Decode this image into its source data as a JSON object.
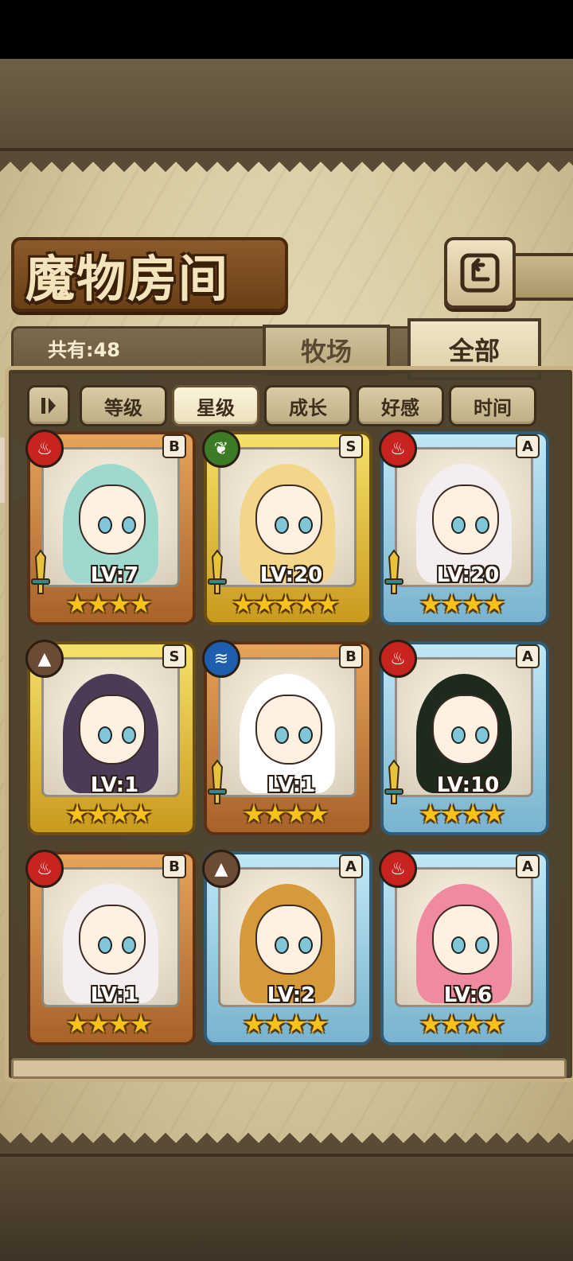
{
  "header": {
    "title": "魔物房间",
    "back_icon": "return-arrow-icon"
  },
  "summary": {
    "count_label": "共有:48"
  },
  "tabs": [
    {
      "label": "牧场",
      "active": false
    },
    {
      "label": "全部",
      "active": true
    }
  ],
  "sort": {
    "toggle_icon": "sort-order-icon",
    "options": [
      {
        "label": "等级",
        "active": false
      },
      {
        "label": "星级",
        "active": true
      },
      {
        "label": "成长",
        "active": false
      },
      {
        "label": "好感",
        "active": false
      },
      {
        "label": "时间",
        "active": false
      }
    ]
  },
  "monsters": [
    {
      "element": "fire",
      "rank": "B",
      "frame": "bronze",
      "level": "LV:7",
      "stars": 4,
      "equipped": true,
      "hair": "#9fd8cf"
    },
    {
      "element": "nature",
      "rank": "S",
      "frame": "gold",
      "level": "LV:20",
      "stars": 5,
      "equipped": true,
      "hair": "#f3d68a"
    },
    {
      "element": "fire",
      "rank": "A",
      "frame": "blue",
      "level": "LV:20",
      "stars": 4,
      "equipped": true,
      "hair": "#f4eef0"
    },
    {
      "element": "earth",
      "rank": "S",
      "frame": "gold",
      "level": "LV:1",
      "stars": 4,
      "equipped": false,
      "hair": "#4b3b57"
    },
    {
      "element": "water",
      "rank": "B",
      "frame": "bronze",
      "level": "LV:1",
      "stars": 4,
      "equipped": true,
      "hair": "#ffffff"
    },
    {
      "element": "fire",
      "rank": "A",
      "frame": "blue",
      "level": "LV:10",
      "stars": 4,
      "equipped": true,
      "hair": "#1e2a1c"
    },
    {
      "element": "fire",
      "rank": "B",
      "frame": "bronze",
      "level": "LV:1",
      "stars": 4,
      "equipped": false,
      "hair": "#f4eef0"
    },
    {
      "element": "earth",
      "rank": "A",
      "frame": "blue",
      "level": "LV:2",
      "stars": 4,
      "equipped": false,
      "hair": "#d69a3a"
    },
    {
      "element": "fire",
      "rank": "A",
      "frame": "blue",
      "level": "LV:6",
      "stars": 4,
      "equipped": false,
      "hair": "#f08aa0"
    }
  ],
  "colors": {
    "fire": "#c8241f",
    "nature": "#3d7c26",
    "water": "#1d5fae",
    "earth": "#6b4a36",
    "star": "#f7c21b"
  }
}
